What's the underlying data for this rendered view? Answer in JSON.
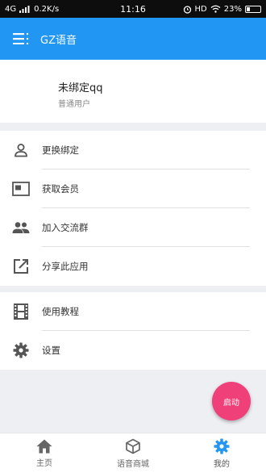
{
  "status_bar": {
    "network": "4G",
    "speed": "0.2K/s",
    "time": "11:16",
    "hd": "HD",
    "battery": "23%"
  },
  "app_bar": {
    "title": "GZ语音"
  },
  "profile": {
    "name": "未绑定qq",
    "role": "普通用户"
  },
  "menu_group_1": [
    {
      "label": "更换绑定",
      "icon": "person-icon"
    },
    {
      "label": "获取会员",
      "icon": "monitor-icon"
    },
    {
      "label": "加入交流群",
      "icon": "people-icon"
    },
    {
      "label": "分享此应用",
      "icon": "share-icon"
    }
  ],
  "menu_group_2": [
    {
      "label": "使用教程",
      "icon": "film-icon"
    },
    {
      "label": "设置",
      "icon": "gear-icon"
    }
  ],
  "fab": {
    "label": "启动",
    "color": "#f0407a"
  },
  "bottom_nav": [
    {
      "label": "主页",
      "icon": "home-icon"
    },
    {
      "label": "语音商城",
      "icon": "cube-icon"
    },
    {
      "label": "我的",
      "icon": "gear-icon",
      "active": true
    }
  ],
  "colors": {
    "primary": "#2196f3",
    "accent": "#f0407a"
  }
}
